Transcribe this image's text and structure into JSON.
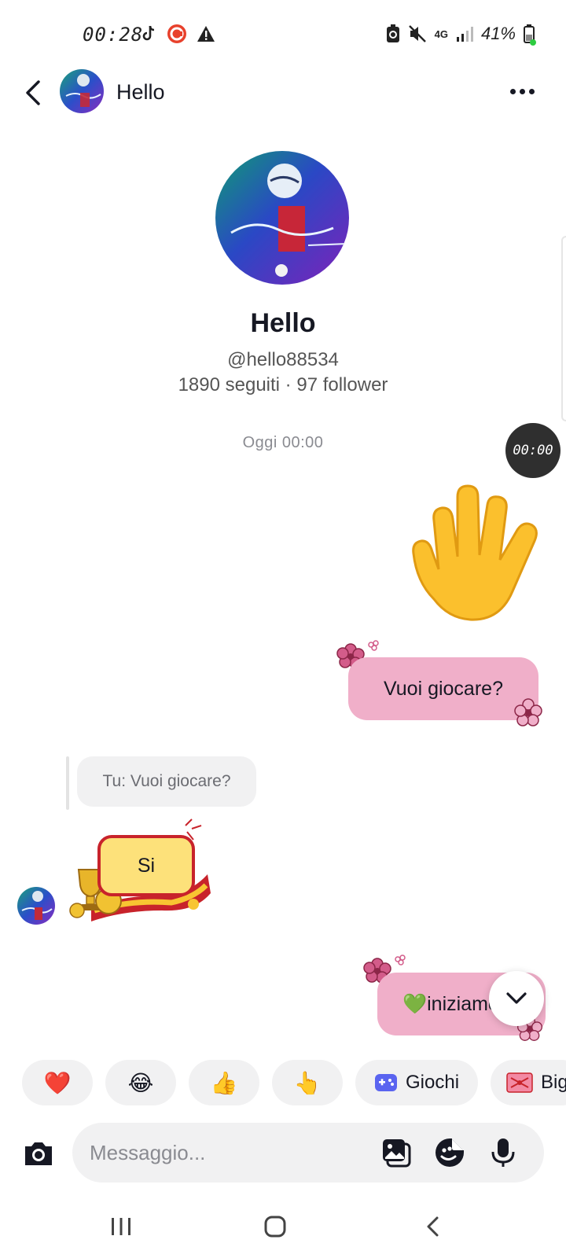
{
  "status_bar": {
    "time": "00:28",
    "battery": "41%",
    "network": "4G"
  },
  "header": {
    "name": "Hello"
  },
  "profile": {
    "name": "Hello",
    "handle": "@hello88534",
    "stats": "1890 seguiti · 97 follower"
  },
  "chat": {
    "date_separator": "Oggi 00:00",
    "time_bubble": "00:00",
    "messages": [
      {
        "from": "me",
        "type": "sticker",
        "emoji": "waving-hand"
      },
      {
        "from": "me",
        "text": "Vuoi giocare?"
      },
      {
        "from": "them",
        "reply_preview": "Tu: Vuoi giocare?",
        "text": "Si"
      },
      {
        "from": "me",
        "text": "💚iniziamo"
      }
    ]
  },
  "quick_replies": [
    {
      "label": "❤️",
      "icon": "heart-emoji"
    },
    {
      "label": "😂",
      "icon": "laughing-emoji"
    },
    {
      "label": "👍",
      "icon": "thumbs-up-emoji"
    },
    {
      "label": "👆",
      "icon": "pointing-up-emoji"
    },
    {
      "label": "Giochi",
      "icon": "gamepad-icon"
    },
    {
      "label": "Big",
      "icon": "gift-icon"
    }
  ],
  "composer": {
    "placeholder": "Messaggio..."
  },
  "colors": {
    "pink_bubble": "#f0afc9",
    "gray_bubble": "#f1f1f2",
    "sticker_yellow": "#fde17a",
    "sticker_red": "#c8232b"
  }
}
